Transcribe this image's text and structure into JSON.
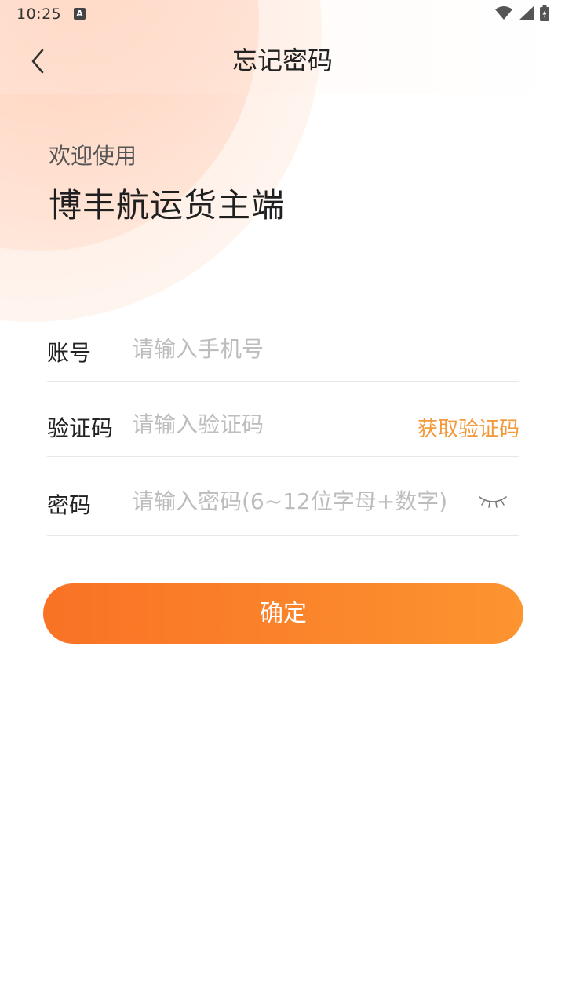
{
  "status_bar": {
    "time": "10:25",
    "notification_letter": "A"
  },
  "header": {
    "title": "忘记密码"
  },
  "welcome": {
    "subtitle": "欢迎使用",
    "app_name": "博丰航运货主端"
  },
  "form": {
    "account": {
      "label": "账号",
      "placeholder": "请输入手机号",
      "value": ""
    },
    "code": {
      "label": "验证码",
      "placeholder": "请输入验证码",
      "value": "",
      "get_code_label": "获取验证码"
    },
    "password": {
      "label": "密码",
      "placeholder": "请输入密码(6~12位字母+数字)",
      "value": ""
    }
  },
  "confirm_label": "确定",
  "colors": {
    "accent": "#f97225",
    "accent_end": "#fc9430",
    "link": "#f29a3a",
    "divider": "#e8e8e8"
  },
  "icons": {
    "back": "chevron-left-icon",
    "eye": "eye-closed-icon",
    "wifi": "wifi-icon",
    "signal": "signal-icon",
    "battery": "battery-charging-icon"
  }
}
